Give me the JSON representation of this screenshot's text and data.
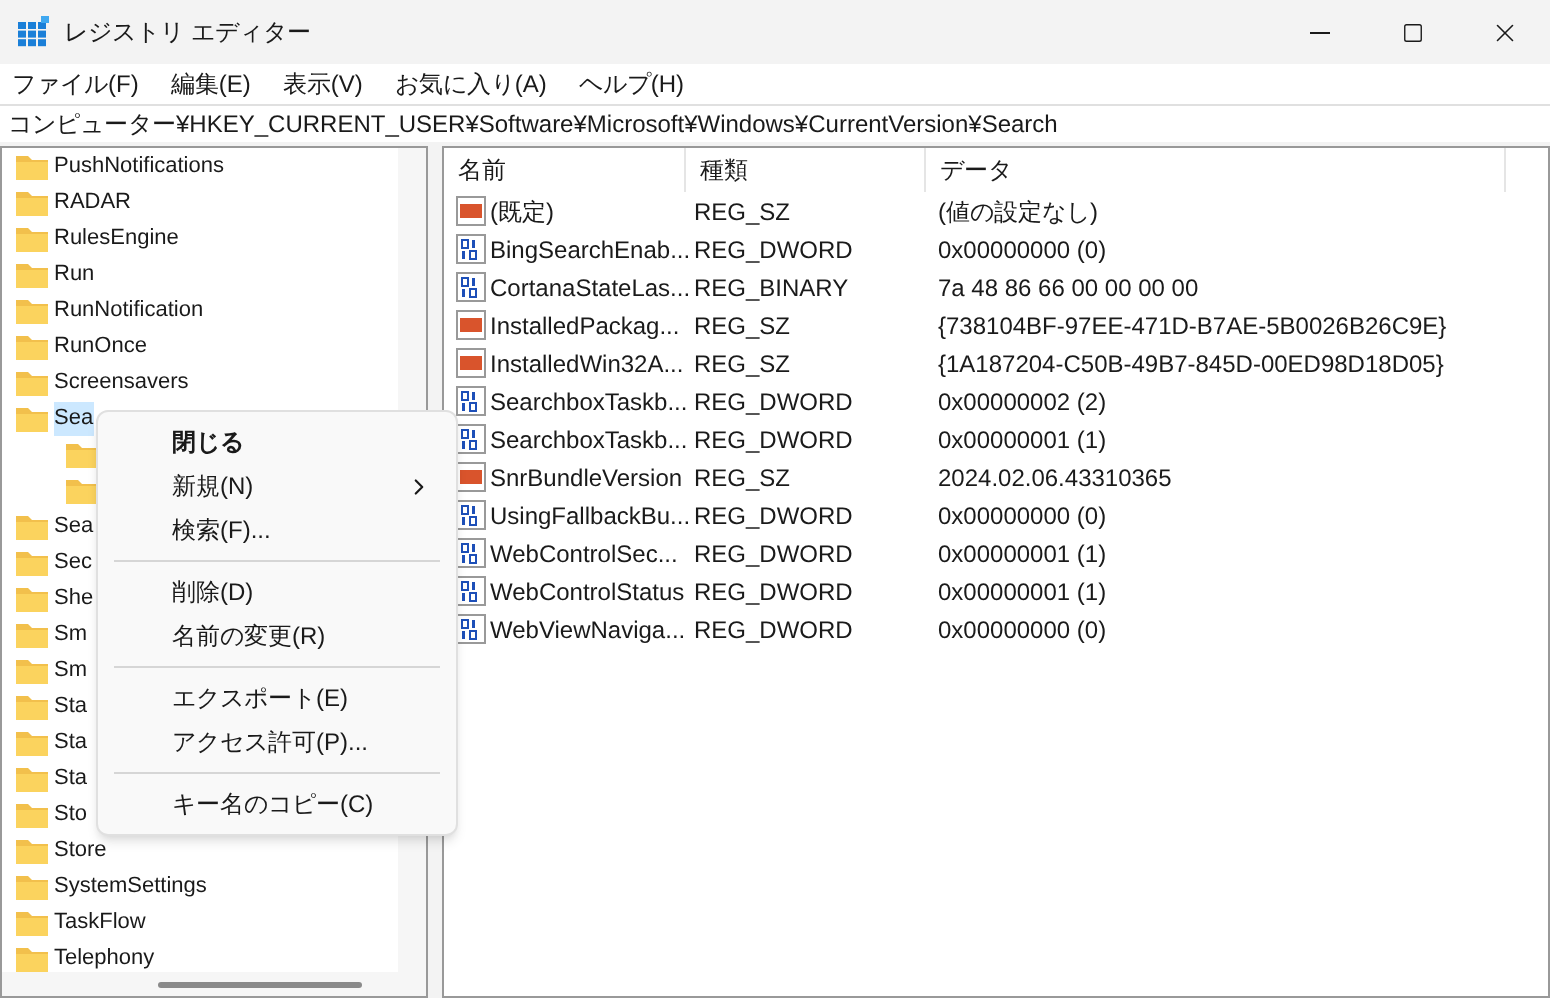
{
  "window": {
    "title": "レジストリ エディター"
  },
  "menu_bar": [
    "ファイル(F)",
    "編集(E)",
    "表示(V)",
    "お気に入り(A)",
    "ヘルプ(H)"
  ],
  "address": "コンピューター¥HKEY_CURRENT_USER¥Software¥Microsoft¥Windows¥CurrentVersion¥Search",
  "tree": {
    "items": [
      {
        "label": "PushNotifications",
        "selected": false
      },
      {
        "label": "RADAR",
        "selected": false
      },
      {
        "label": "RulesEngine",
        "selected": false
      },
      {
        "label": "Run",
        "selected": false
      },
      {
        "label": "RunNotification",
        "selected": false
      },
      {
        "label": "RunOnce",
        "selected": false
      },
      {
        "label": "Screensavers",
        "selected": false
      },
      {
        "label": "Sea",
        "selected": true,
        "children": [
          {
            "selected": false
          },
          {
            "selected": false
          }
        ]
      },
      {
        "label": "Sea",
        "selected": false
      },
      {
        "label": "Sec",
        "selected": false
      },
      {
        "label": "She",
        "selected": false
      },
      {
        "label": "Sm",
        "selected": false
      },
      {
        "label": "Sm",
        "selected": false
      },
      {
        "label": "Sta",
        "selected": false
      },
      {
        "label": "Sta",
        "selected": false
      },
      {
        "label": "Sta",
        "selected": false
      },
      {
        "label": "Sto",
        "selected": false
      },
      {
        "label": "Store",
        "selected": false
      },
      {
        "label": "SystemSettings",
        "selected": false
      },
      {
        "label": "TaskFlow",
        "selected": false
      },
      {
        "label": "Telephony",
        "selected": false
      }
    ]
  },
  "table": {
    "columns": [
      "名前",
      "種類",
      "データ"
    ],
    "rows": [
      {
        "kind": "string",
        "name": "(既定)",
        "type": "REG_SZ",
        "data": "(値の設定なし)"
      },
      {
        "kind": "binary",
        "name": "BingSearchEnab...",
        "type": "REG_DWORD",
        "data": "0x00000000 (0)"
      },
      {
        "kind": "binary",
        "name": "CortanaStateLas...",
        "type": "REG_BINARY",
        "data": "7a 48 86 66 00 00 00 00"
      },
      {
        "kind": "string",
        "name": "InstalledPackag...",
        "type": "REG_SZ",
        "data": "{738104BF-97EE-471D-B7AE-5B0026B26C9E}"
      },
      {
        "kind": "string",
        "name": "InstalledWin32A...",
        "type": "REG_SZ",
        "data": "{1A187204-C50B-49B7-845D-00ED98D18D05}"
      },
      {
        "kind": "binary",
        "name": "SearchboxTaskb...",
        "type": "REG_DWORD",
        "data": "0x00000002 (2)"
      },
      {
        "kind": "binary",
        "name": "SearchboxTaskb...",
        "type": "REG_DWORD",
        "data": "0x00000001 (1)"
      },
      {
        "kind": "string",
        "name": "SnrBundleVersion",
        "type": "REG_SZ",
        "data": "2024.02.06.43310365"
      },
      {
        "kind": "binary",
        "name": "UsingFallbackBu...",
        "type": "REG_DWORD",
        "data": "0x00000000 (0)"
      },
      {
        "kind": "binary",
        "name": "WebControlSec...",
        "type": "REG_DWORD",
        "data": "0x00000001 (1)"
      },
      {
        "kind": "binary",
        "name": "WebControlStatus",
        "type": "REG_DWORD",
        "data": "0x00000001 (1)"
      },
      {
        "kind": "binary",
        "name": "WebViewNaviga...",
        "type": "REG_DWORD",
        "data": "0x00000000 (0)"
      }
    ]
  },
  "context_menu": [
    {
      "kind": "item",
      "label": "閉じる",
      "default": true,
      "submenu": false
    },
    {
      "kind": "item",
      "label": "新規(N)",
      "default": false,
      "submenu": true
    },
    {
      "kind": "item",
      "label": "検索(F)...",
      "default": false,
      "submenu": false
    },
    {
      "kind": "separator"
    },
    {
      "kind": "item",
      "label": "削除(D)",
      "default": false,
      "submenu": false
    },
    {
      "kind": "item",
      "label": "名前の変更(R)",
      "default": false,
      "submenu": false
    },
    {
      "kind": "separator"
    },
    {
      "kind": "item",
      "label": "エクスポート(E)",
      "default": false,
      "submenu": false
    },
    {
      "kind": "item",
      "label": "アクセス許可(P)...",
      "default": false,
      "submenu": false
    },
    {
      "kind": "separator"
    },
    {
      "kind": "item",
      "label": "キー名のコピー(C)",
      "default": false,
      "submenu": false
    }
  ]
}
